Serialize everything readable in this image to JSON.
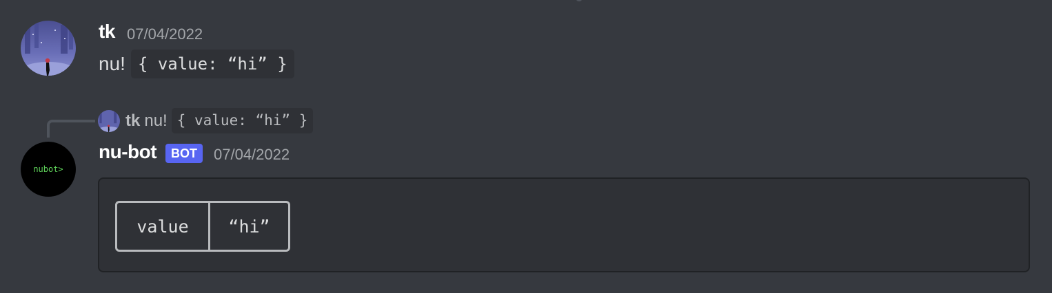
{
  "messages": [
    {
      "username": "tk",
      "timestamp": "07/04/2022",
      "text": "nu!",
      "inline_code": "{ value: “hi” }"
    },
    {
      "reply": {
        "username": "tk",
        "text": "nu!",
        "inline_code": "{ value: “hi” }"
      },
      "username": "nu-bot",
      "bot_tag": "BOT",
      "timestamp": "07/04/2022",
      "avatar_text": "nubot>",
      "table": {
        "key": "value",
        "value": "“hi”"
      }
    }
  ],
  "colors": {
    "background": "#36393f",
    "code_background": "#2f3136",
    "bot_tag": "#5865f2",
    "avatar_text": "#5fd35a"
  },
  "icons": {
    "avatar_tk": "night-forest-figure-avatar",
    "avatar_bot": "terminal-prompt-avatar"
  }
}
